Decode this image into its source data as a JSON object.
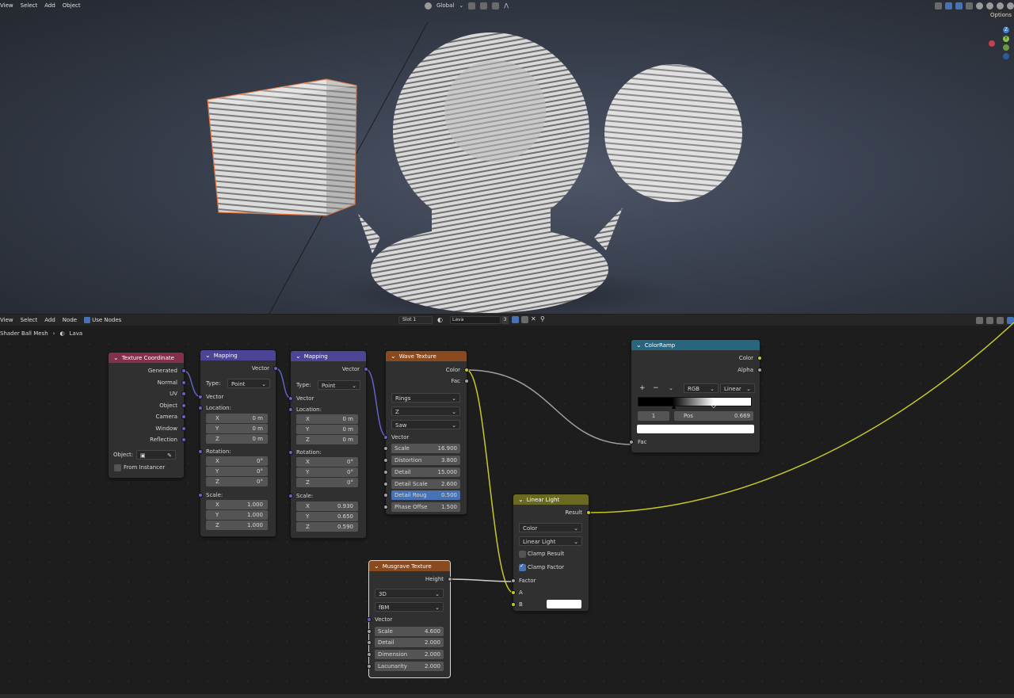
{
  "viewport": {
    "menu": [
      "View",
      "Select",
      "Add",
      "Object"
    ],
    "transform_orientation": "Global",
    "options_label": "Options",
    "gizmo_axes": {
      "z": "Z",
      "y": "Y"
    }
  },
  "node_editor": {
    "menu": [
      "View",
      "Select",
      "Add",
      "Node"
    ],
    "use_nodes_label": "Use Nodes",
    "slot": "Slot 1",
    "material": "Lava",
    "users": "3",
    "breadcrumb": [
      "Shader Ball Mesh",
      "Lava"
    ]
  },
  "nodes": {
    "texcoord": {
      "title": "Texture Coordinate",
      "outputs": [
        "Generated",
        "Normal",
        "UV",
        "Object",
        "Camera",
        "Window",
        "Reflection"
      ],
      "object_label": "Object:",
      "from_instancer": "From Instancer"
    },
    "mapping1": {
      "title": "Mapping",
      "output": "Vector",
      "type_label": "Type:",
      "type": "Point",
      "vector": "Vector",
      "location": "Location:",
      "rotation": "Rotation:",
      "scale": "Scale:",
      "loc": [
        "0 m",
        "0 m",
        "0 m"
      ],
      "rot": [
        "0°",
        "0°",
        "0°"
      ],
      "scl": [
        "1.000",
        "1.000",
        "1.000"
      ]
    },
    "mapping2": {
      "title": "Mapping",
      "output": "Vector",
      "type_label": "Type:",
      "type": "Point",
      "vector": "Vector",
      "location": "Location:",
      "rotation": "Rotation:",
      "scale": "Scale:",
      "loc": [
        "0 m",
        "0 m",
        "0 m"
      ],
      "rot": [
        "0°",
        "0°",
        "0°"
      ],
      "scl": [
        "0.930",
        "0.650",
        "0.590"
      ]
    },
    "axes": [
      "X",
      "Y",
      "Z"
    ],
    "wave": {
      "title": "Wave Texture",
      "out_color": "Color",
      "out_fac": "Fac",
      "wave_type": "Rings",
      "direction": "Z",
      "profile": "Saw",
      "vector": "Vector",
      "params": [
        {
          "label": "Scale",
          "value": "16.900"
        },
        {
          "label": "Distortion",
          "value": "3.800"
        },
        {
          "label": "Detail",
          "value": "15.000"
        },
        {
          "label": "Detail Scale",
          "value": "2.600"
        },
        {
          "label": "Detail Roug",
          "value": "0.500"
        },
        {
          "label": "Phase Offse",
          "value": "1.500"
        }
      ]
    },
    "musgrave": {
      "title": "Musgrave Texture",
      "output": "Height",
      "dims": "3D",
      "type": "fBM",
      "vector": "Vector",
      "params": [
        {
          "label": "Scale",
          "value": "4.600"
        },
        {
          "label": "Detail",
          "value": "2.000"
        },
        {
          "label": "Dimension",
          "value": "2.000"
        },
        {
          "label": "Lacunarity",
          "value": "2.000"
        }
      ]
    },
    "colorramp": {
      "title": "ColorRamp",
      "out_color": "Color",
      "out_alpha": "Alpha",
      "mode": "RGB",
      "interp": "Linear",
      "index": "1",
      "pos_label": "Pos",
      "pos": "0.669",
      "input": "Fac",
      "stop_position": 0.669
    },
    "linearlight": {
      "title": "Linear Light",
      "output": "Result",
      "mode": "Color",
      "blend": "Linear Light",
      "clamp_result": "Clamp Result",
      "clamp_factor": "Clamp Factor",
      "factor": "Factor",
      "a": "A",
      "b": "B"
    }
  },
  "colors": {
    "accent": "#4772b3",
    "vector_socket": "#6363c7",
    "color_socket": "#c7c729",
    "float_socket": "#a1a1a1"
  }
}
